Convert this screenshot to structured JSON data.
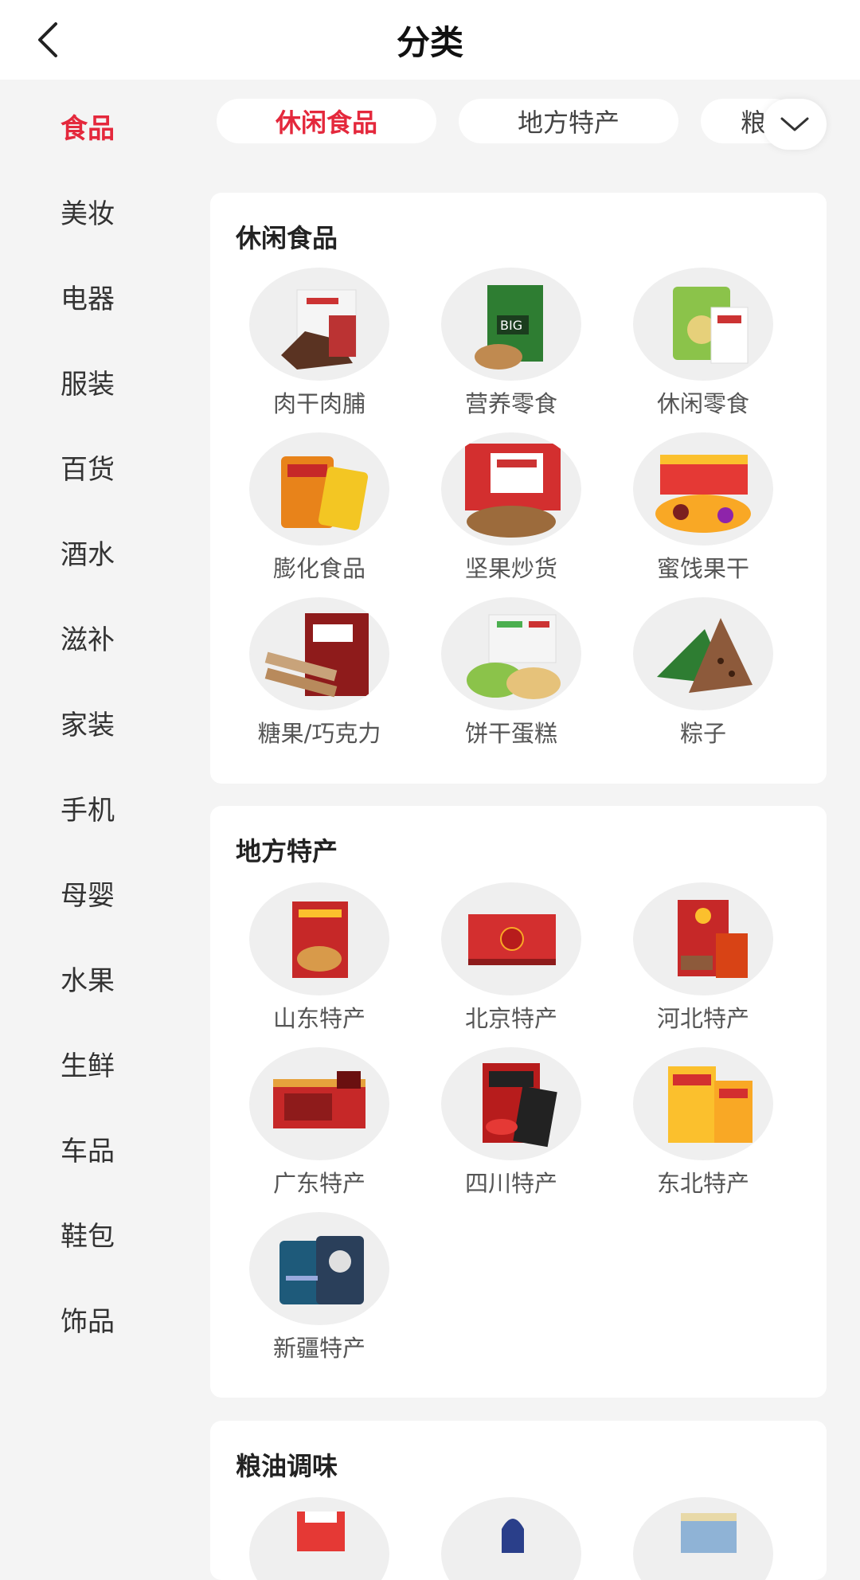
{
  "header": {
    "title": "分类"
  },
  "sidebar": {
    "items": [
      "食品",
      "美妆",
      "电器",
      "服装",
      "百货",
      "酒水",
      "滋补",
      "家装",
      "手机",
      "母婴",
      "水果",
      "生鲜",
      "车品",
      "鞋包",
      "饰品"
    ]
  },
  "tabs": [
    {
      "label": "休闲食品",
      "active": true
    },
    {
      "label": "地方特产",
      "active": false
    },
    {
      "label": "粮",
      "active": false
    }
  ],
  "sections": [
    {
      "title": "休闲食品",
      "items": [
        {
          "label": "肉干肉脯",
          "icon": "jerky-image"
        },
        {
          "label": "营养零食",
          "icon": "seaweed-snack-image"
        },
        {
          "label": "休闲零食",
          "icon": "chips-image"
        },
        {
          "label": "膨化食品",
          "icon": "puffed-snack-image"
        },
        {
          "label": "坚果炒货",
          "icon": "nuts-image"
        },
        {
          "label": "蜜饯果干",
          "icon": "dried-fruit-image"
        },
        {
          "label": "糖果/巧克力",
          "icon": "candy-image"
        },
        {
          "label": "饼干蛋糕",
          "icon": "biscuit-image"
        },
        {
          "label": "粽子",
          "icon": "zongzi-image"
        }
      ]
    },
    {
      "title": "地方特产",
      "items": [
        {
          "label": "山东特产",
          "icon": "shandong-specialty-image"
        },
        {
          "label": "北京特产",
          "icon": "beijing-specialty-image"
        },
        {
          "label": "河北特产",
          "icon": "hebei-specialty-image"
        },
        {
          "label": "广东特产",
          "icon": "guangdong-specialty-image"
        },
        {
          "label": "四川特产",
          "icon": "sichuan-specialty-image"
        },
        {
          "label": "东北特产",
          "icon": "northeast-specialty-image"
        },
        {
          "label": "新疆特产",
          "icon": "xinjiang-specialty-image"
        }
      ]
    },
    {
      "title": "粮油调味",
      "items": [
        {
          "label": "",
          "icon": "grain-image"
        },
        {
          "label": "",
          "icon": "oil-image"
        },
        {
          "label": "",
          "icon": "seasoning-image"
        }
      ]
    }
  ],
  "colors": {
    "accent": "#e4283c",
    "background": "#f4f4f4",
    "card": "#ffffff"
  }
}
